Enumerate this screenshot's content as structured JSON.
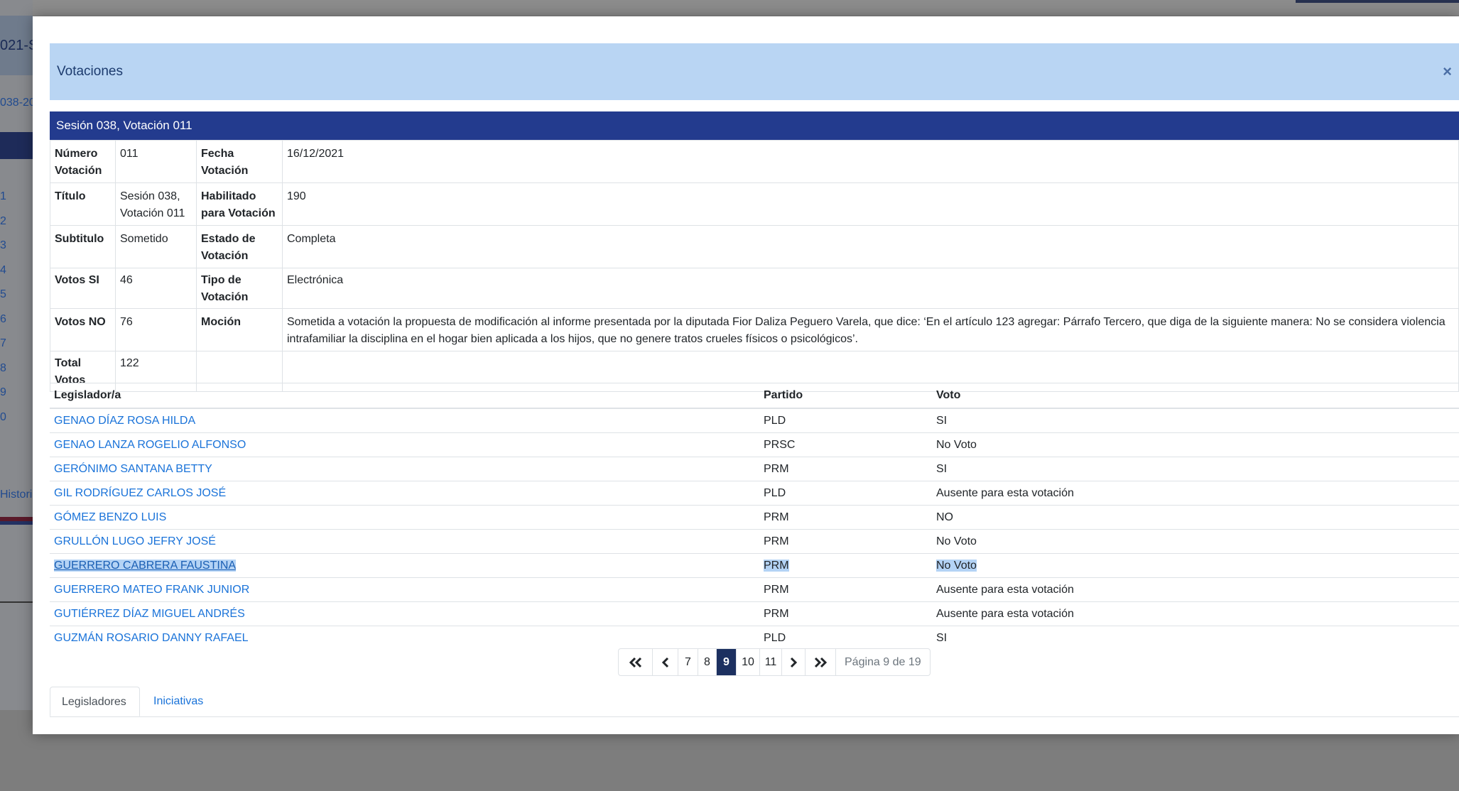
{
  "background": {
    "title_fragment": "021-S",
    "subtitle_fragment": "038-20",
    "numbers": [
      "1",
      "2",
      "3",
      "4",
      "5",
      "6",
      "7",
      "8",
      "9",
      "0"
    ],
    "history_fragment": "Histori"
  },
  "modal": {
    "title": "Votaciones",
    "close_glyph": "×"
  },
  "detail": {
    "header": "Sesión 038, Votación 011",
    "labels": {
      "numero": "Número Votación",
      "titulo": "Título",
      "subtitulo": "Subtitulo",
      "votos_si": "Votos SI",
      "votos_no": "Votos NO",
      "total": "Total Votos",
      "fecha": "Fecha Votación",
      "habilitado": "Habilitado para Votación",
      "estado": "Estado de Votación",
      "tipo": "Tipo de Votación",
      "mocion": "Moción"
    },
    "values": {
      "numero": "011",
      "titulo": "Sesión 038, Votación 011",
      "subtitulo": "Sometido",
      "votos_si": "46",
      "votos_no": "76",
      "total": "122",
      "fecha": "16/12/2021",
      "habilitado": "190",
      "estado": "Completa",
      "tipo": "Electrónica",
      "mocion": "Sometida a votación la propuesta de modificación al informe presentada por la diputada Fior Daliza Peguero Varela, que dice: ‘En el artículo 123 agregar: Párrafo Tercero, que diga de la siguiente manera: No se considera violencia intrafamiliar la disciplina en el hogar bien aplicada a los hijos, que no genere tratos crueles físicos o psicológicos’."
    }
  },
  "votes": {
    "columns": [
      "Legislador/a",
      "Partido",
      "Voto"
    ],
    "rows": [
      {
        "name": "GENAO DÍAZ ROSA HILDA",
        "party": "PLD",
        "vote": "SI"
      },
      {
        "name": "GENAO LANZA ROGELIO ALFONSO",
        "party": "PRSC",
        "vote": "No Voto"
      },
      {
        "name": "GERÓNIMO SANTANA BETTY",
        "party": "PRM",
        "vote": "SI"
      },
      {
        "name": "GIL RODRÍGUEZ CARLOS JOSÉ",
        "party": "PLD",
        "vote": "Ausente para esta votación"
      },
      {
        "name": "GÓMEZ BENZO LUIS",
        "party": "PRM",
        "vote": "NO"
      },
      {
        "name": "GRULLÓN LUGO JEFRY JOSÉ",
        "party": "PRM",
        "vote": "No Voto"
      },
      {
        "name": "GUERRERO CABRERA FAUSTINA",
        "party": "PRM",
        "vote": "No Voto"
      },
      {
        "name": "GUERRERO MATEO FRANK JUNIOR",
        "party": "PRM",
        "vote": "Ausente para esta votación"
      },
      {
        "name": "GUTIÉRREZ DÍAZ MIGUEL ANDRÉS",
        "party": "PRM",
        "vote": "Ausente para esta votación"
      },
      {
        "name": "GUZMÁN ROSARIO DANNY RAFAEL",
        "party": "PLD",
        "vote": "SI"
      }
    ],
    "selected_row": 6
  },
  "pagination": {
    "pages": [
      "7",
      "8",
      "9",
      "10",
      "11"
    ],
    "current": "9",
    "info": "Página 9 de 19"
  },
  "tabs": {
    "legisladores": "Legisladores",
    "iniciativas": "Iniciativas"
  },
  "colors": {
    "header_band": "#233b8e",
    "modal_header": "#b9d5f3",
    "link": "#1a73d9",
    "pager_active": "#1c3060"
  }
}
